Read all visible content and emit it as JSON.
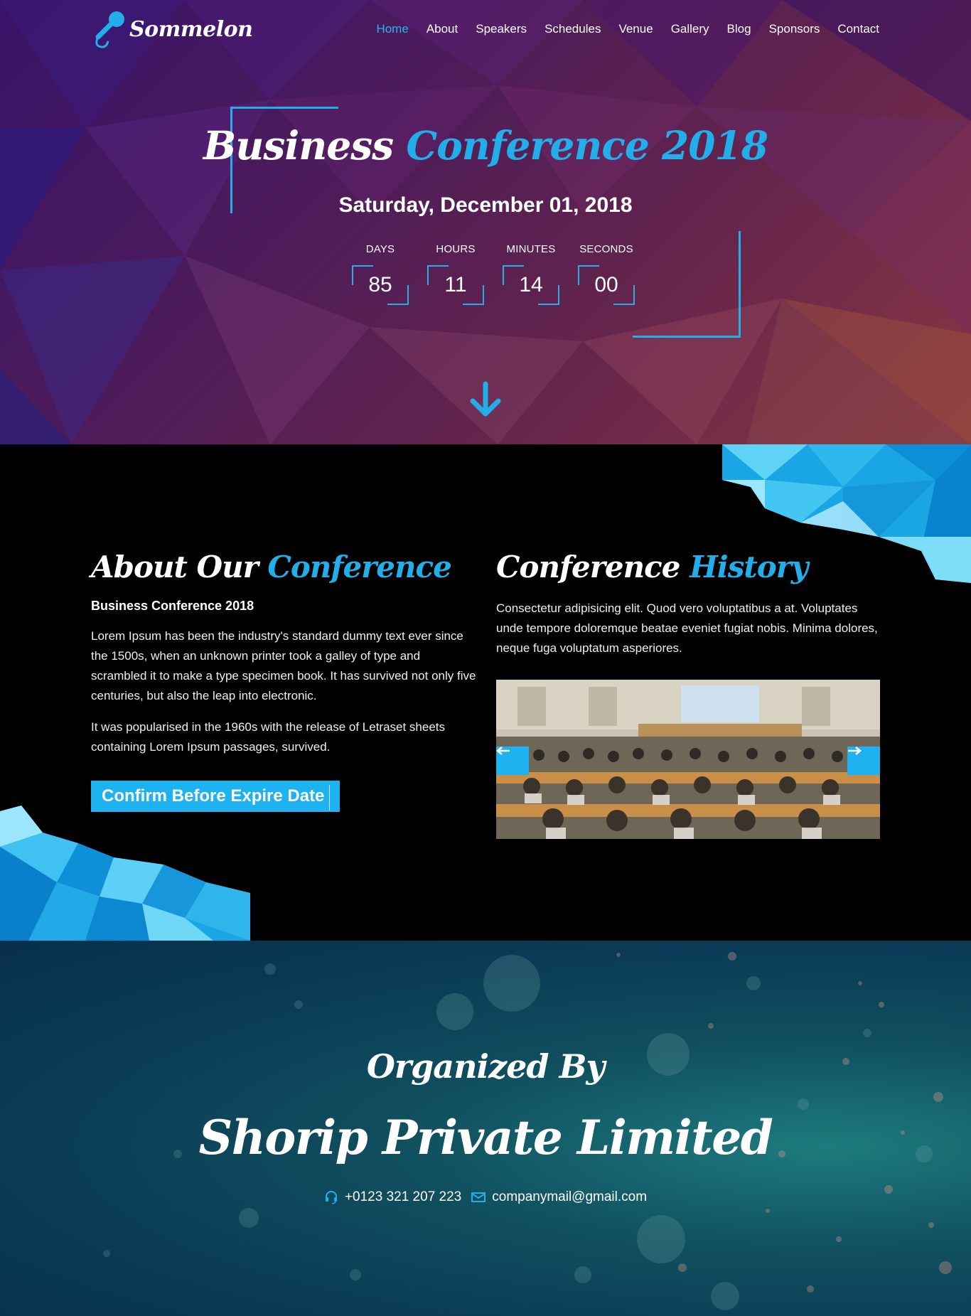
{
  "brand": {
    "name": "Sommelon",
    "accent": "#22aee8"
  },
  "nav": {
    "items": [
      {
        "label": "Home",
        "active": true
      },
      {
        "label": "About"
      },
      {
        "label": "Speakers"
      },
      {
        "label": "Schedules"
      },
      {
        "label": "Venue"
      },
      {
        "label": "Gallery"
      },
      {
        "label": "Blog"
      },
      {
        "label": "Sponsors"
      },
      {
        "label": "Contact"
      }
    ]
  },
  "hero": {
    "title_part1": "Business",
    "title_part2": "Conference 2018",
    "date": "Saturday, December 01, 2018",
    "countdown": [
      {
        "label": "DAYS",
        "value": "85"
      },
      {
        "label": "HOURS",
        "value": "11"
      },
      {
        "label": "MINUTES",
        "value": "14"
      },
      {
        "label": "SECONDS",
        "value": "00"
      }
    ],
    "scroll_icon": "arrow-down-icon"
  },
  "about": {
    "title_part1": "About Our",
    "title_part2": "Conference",
    "subtitle": "Business Conference 2018",
    "paragraph1": "Lorem Ipsum has been the industry's standard dummy text ever since the 1500s, when an unknown printer took a galley of type and scrambled it to make a type specimen book. It has survived not only five centuries, but also the leap into electronic.",
    "paragraph2": "It was popularised in the 1960s with the release of Letraset sheets containing Lorem Ipsum passages, survived.",
    "cta_label": "Confirm Before Expire Date"
  },
  "history": {
    "title_part1": "Conference",
    "title_part2": "History",
    "text": "Consectetur adipisicing elit. Quod vero voluptatibus a at. Voluptates unde tempore doloremque beatae eveniet fugiat nobis. Minima dolores, neque fuga voluptatum asperiores.",
    "slider_prev_icon": "arrow-left-icon",
    "slider_next_icon": "arrow-right-icon"
  },
  "organizer": {
    "heading": "Organized By",
    "name": "Shorip Private Limited",
    "phone": "+0123 321 207 223",
    "email": "companymail@gmail.com",
    "phone_icon": "headset-icon",
    "email_icon": "envelope-icon"
  }
}
